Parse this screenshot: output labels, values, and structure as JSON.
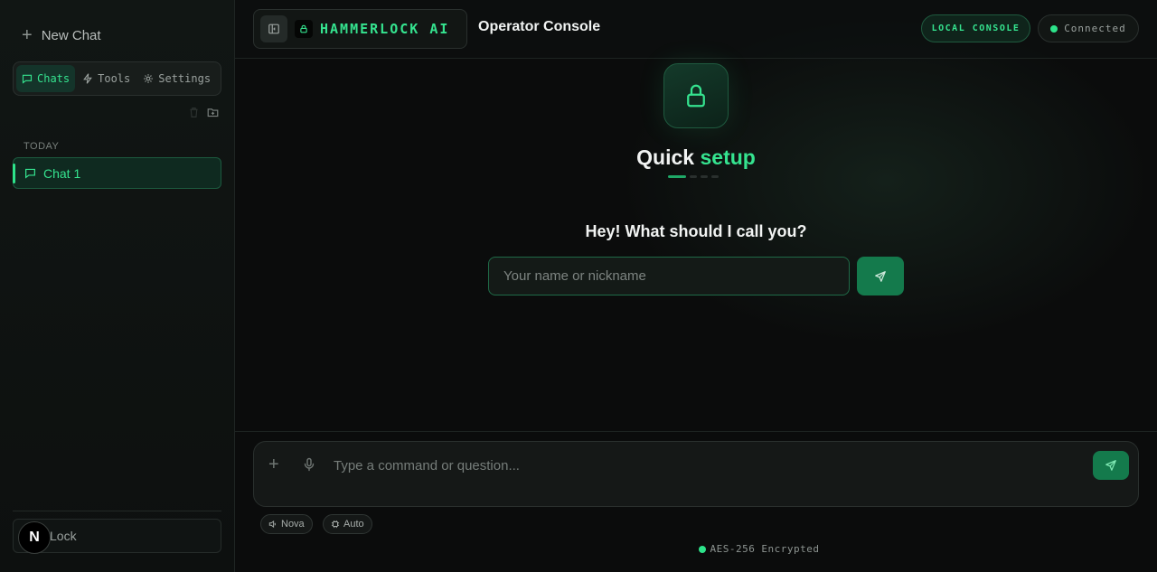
{
  "sidebar": {
    "new_chat_label": "New Chat",
    "tabs": [
      {
        "label": "Chats",
        "icon": "chat-icon",
        "active": true
      },
      {
        "label": "Tools",
        "icon": "bolt-icon",
        "active": false
      },
      {
        "label": "Settings",
        "icon": "gear-icon",
        "active": false
      }
    ],
    "section_label": "TODAY",
    "chats": [
      {
        "label": "Chat 1",
        "active": true
      }
    ],
    "lock_label": "Lock",
    "avatar_letter": "N"
  },
  "header": {
    "brand": "HAMMERLOCK AI",
    "title": "Operator Console",
    "badge_local": "LOCAL CONSOLE",
    "status": "Connected"
  },
  "setup": {
    "title_part1": "Quick",
    "title_part2": "setup",
    "step_current": 1,
    "step_total": 4,
    "question": "Hey! What should I call you?",
    "name_placeholder": "Your name or nickname"
  },
  "composer": {
    "placeholder": "Type a command or question...",
    "chip_voice": "Nova",
    "chip_model": "Auto"
  },
  "footer": {
    "encryption": "AES-256 Encrypted"
  },
  "colors": {
    "accent": "#35e38f",
    "accent_dark": "#147a4c",
    "background": "#0b0c0c"
  }
}
